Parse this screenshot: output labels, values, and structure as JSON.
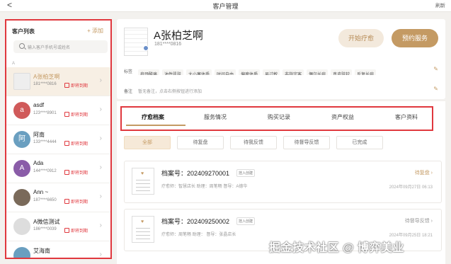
{
  "topbar": {
    "title": "客户管理",
    "refresh": "刷新",
    "back": "<"
  },
  "left": {
    "title": "客户列表",
    "add": "+ 添加",
    "search_placeholder": "输入客户手机号或姓名",
    "section": "A",
    "customers": [
      {
        "name": "A张柏芝啊",
        "phone": "181****0816",
        "badge": "即将到期",
        "avatar_text": "",
        "avatar_color": "#eeeeee",
        "selected": true
      },
      {
        "name": "asdf",
        "phone": "123****8901",
        "badge": "即将到期",
        "avatar_text": "a",
        "avatar_color": "#d05a5a",
        "selected": false
      },
      {
        "name": "阿南",
        "phone": "133****4444",
        "badge": "即将到期",
        "avatar_text": "阿",
        "avatar_color": "#6a9fc0",
        "selected": false
      },
      {
        "name": "Ada",
        "phone": "144****0912",
        "badge": "即将到期",
        "avatar_text": "A",
        "avatar_color": "#8a5ca8",
        "selected": false
      },
      {
        "name": "Ann ~",
        "phone": "187****6650",
        "badge": "即将到期",
        "avatar_text": "",
        "avatar_color": "#7a6a5a",
        "selected": false
      },
      {
        "name": "A微信测试",
        "phone": "186****0039",
        "badge": "即将到期",
        "avatar_text": "",
        "avatar_color": "#dddddd",
        "selected": false
      },
      {
        "name": "艾海南",
        "phone": "",
        "badge": "",
        "avatar_text": "",
        "avatar_color": "#6a9fc0",
        "selected": false
      }
    ]
  },
  "profile": {
    "name": "A张柏芝啊",
    "phone": "181****0816",
    "start_btn": "开始疗愈",
    "book_btn": "预约服务",
    "tags_label": "标签",
    "tags": [
      "肩颈酸痛",
      "油性肌肤",
      "大小寒体质",
      "时间自由",
      "偏瘦体质",
      "易过敏",
      "非指定客",
      "偶尔长痘",
      "真皮肤较",
      "反复长痘"
    ],
    "note_label": "备注",
    "note": "暂无备注，点击右侧按钮进行添加"
  },
  "tabs": [
    "疗愈档案",
    "服务情况",
    "购买记录",
    "资产权益",
    "客户资料"
  ],
  "filters": [
    "全部",
    "待复盘",
    "待我反馈",
    "待督导反馈",
    "已完成"
  ],
  "records": [
    {
      "no": "档案号：202409270001",
      "source": "挂入创建",
      "meta": "疗愈师：智慧店长    助理：周笔畅    督导：A德华",
      "status": "待复盘",
      "date": "2024年09月27日 06:13"
    },
    {
      "no": "档案号：202409250002",
      "source": "挂入创建",
      "meta": "疗愈师：周笔畅    助理：    督导：张晶店长",
      "status": "待督导反馈",
      "date": "2024年09月25日 18:21"
    }
  ],
  "watermark": "掘金技术社区 @ 博弈美业"
}
